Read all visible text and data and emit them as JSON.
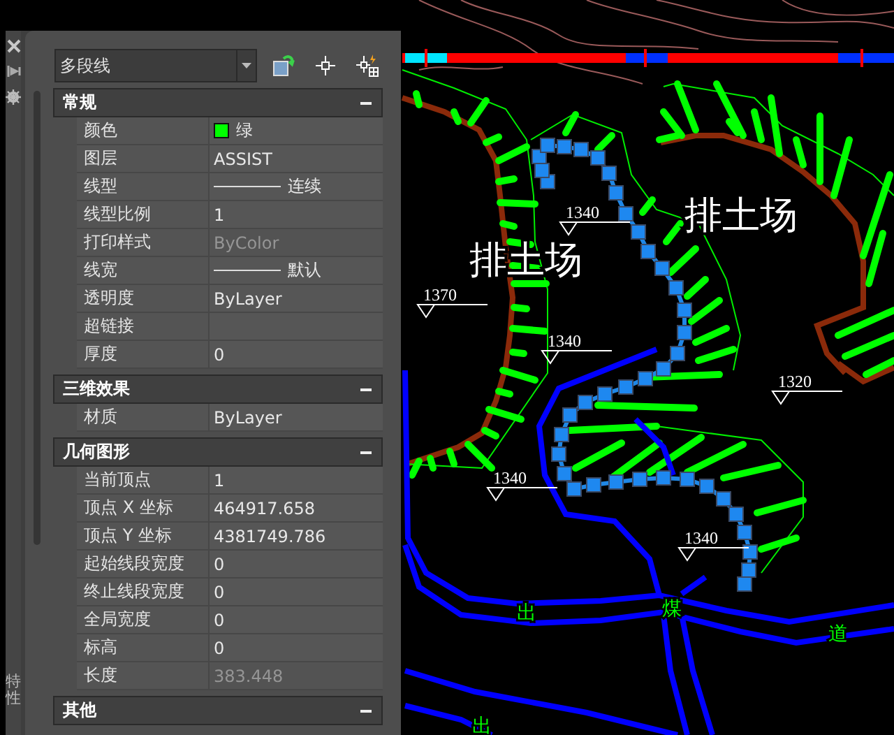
{
  "palette": {
    "side_tab": "特性",
    "object_type": "多段线",
    "sections": [
      {
        "title": "常规",
        "expanded": true,
        "rows": [
          {
            "label": "颜色",
            "value": "绿",
            "kind": "color",
            "color": "#00ff00",
            "disabled": false
          },
          {
            "label": "图层",
            "value": "ASSIST",
            "kind": "text",
            "disabled": false
          },
          {
            "label": "线型",
            "value": "连续",
            "kind": "line",
            "disabled": false
          },
          {
            "label": "线型比例",
            "value": "1",
            "kind": "text",
            "disabled": false
          },
          {
            "label": "打印样式",
            "value": "ByColor",
            "kind": "text",
            "disabled": true
          },
          {
            "label": "线宽",
            "value": "默认",
            "kind": "line",
            "disabled": false
          },
          {
            "label": "透明度",
            "value": "ByLayer",
            "kind": "text",
            "disabled": false
          },
          {
            "label": "超链接",
            "value": "",
            "kind": "text",
            "disabled": false
          },
          {
            "label": "厚度",
            "value": "0",
            "kind": "text",
            "disabled": false
          }
        ]
      },
      {
        "title": "三维效果",
        "expanded": true,
        "rows": [
          {
            "label": "材质",
            "value": "ByLayer",
            "kind": "text",
            "disabled": false
          }
        ]
      },
      {
        "title": "几何图形",
        "expanded": true,
        "rows": [
          {
            "label": "当前顶点",
            "value": "1",
            "kind": "text",
            "disabled": false
          },
          {
            "label": "顶点 X 坐标",
            "value": "464917.658",
            "kind": "text",
            "disabled": false
          },
          {
            "label": "顶点 Y 坐标",
            "value": "4381749.786",
            "kind": "text",
            "disabled": false
          },
          {
            "label": "起始线段宽度",
            "value": "0",
            "kind": "text",
            "disabled": false
          },
          {
            "label": "终止线段宽度",
            "value": "0",
            "kind": "text",
            "disabled": false
          },
          {
            "label": "全局宽度",
            "value": "0",
            "kind": "text",
            "disabled": false
          },
          {
            "label": "标高",
            "value": "0",
            "kind": "text",
            "disabled": false
          },
          {
            "label": "长度",
            "value": "383.448",
            "kind": "text",
            "disabled": true
          }
        ]
      },
      {
        "title": "其他",
        "expanded": true
      }
    ]
  },
  "drawing": {
    "labels": [
      {
        "text": "排土场",
        "kind": "area"
      },
      {
        "text": "排土场",
        "kind": "area"
      },
      {
        "text": "1340",
        "kind": "elevation"
      },
      {
        "text": "1370",
        "kind": "elevation"
      },
      {
        "text": "1340",
        "kind": "elevation"
      },
      {
        "text": "1320",
        "kind": "elevation"
      },
      {
        "text": "1340",
        "kind": "elevation"
      },
      {
        "text": "1340",
        "kind": "elevation"
      },
      {
        "text": "出",
        "kind": "road"
      },
      {
        "text": "煤",
        "kind": "road"
      },
      {
        "text": "道",
        "kind": "road"
      },
      {
        "text": "出",
        "kind": "road"
      }
    ]
  }
}
